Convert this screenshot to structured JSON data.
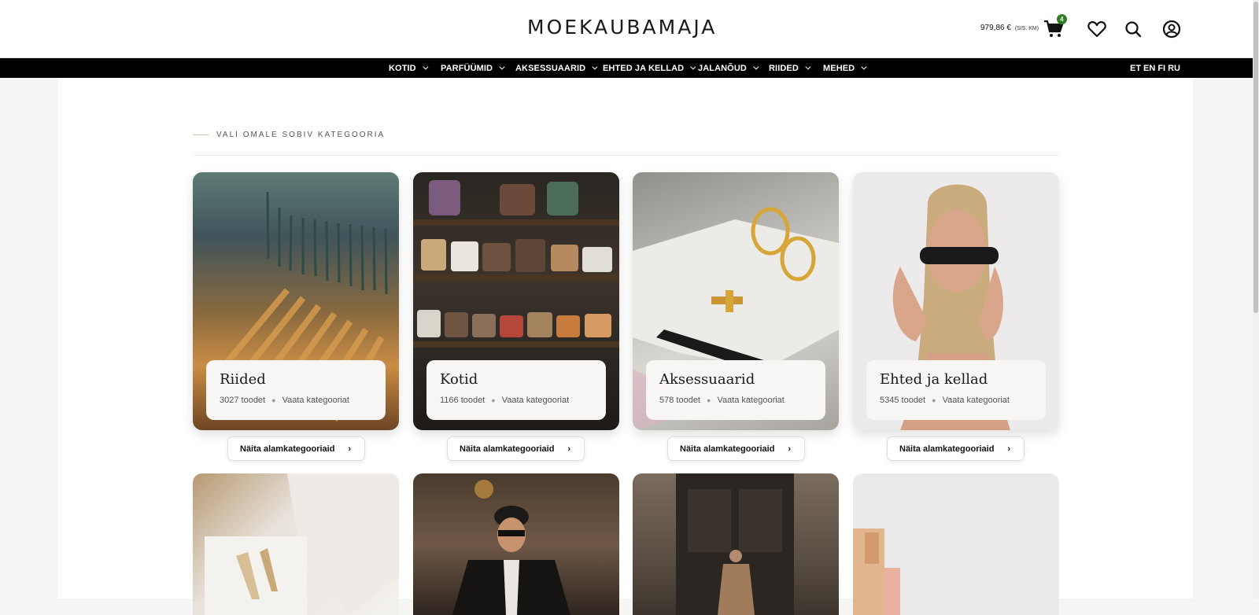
{
  "header": {
    "logo": "MOEKAUBAMAJA",
    "cart_total": "979,86 €",
    "cart_vat": "(SIS. KM)",
    "cart_count": "4"
  },
  "nav": {
    "items": [
      "KOTID",
      "PARFÜÜMID",
      "AKSESSUAARID",
      "EHTED JA KELLAD",
      "JALANÕUD",
      "RIIDED",
      "MEHED"
    ],
    "languages": [
      "ET",
      "EN",
      "FI",
      "RU"
    ]
  },
  "main": {
    "section_label": "VALI OMALE SOBIV KATEGOORIA",
    "cards": [
      {
        "title": "Riided",
        "count": "3027 toodet",
        "link": "Vaata kategooriat",
        "button": "Näita alamkategooriaid"
      },
      {
        "title": "Kotid",
        "count": "1166 toodet",
        "link": "Vaata kategooriat",
        "button": "Näita alamkategooriaid"
      },
      {
        "title": "Aksessuaarid",
        "count": "578 toodet",
        "link": "Vaata kategooriat",
        "button": "Näita alamkategooriaid"
      },
      {
        "title": "Ehted ja kellad",
        "count": "5345 toodet",
        "link": "Vaata kategooriat",
        "button": "Näita alamkategooriaid"
      }
    ]
  },
  "colors": {
    "accent_badge": "#2f7d22",
    "nav_bg": "#000000",
    "page_bg": "#f5f5f4"
  },
  "icons": [
    "cart-icon",
    "heart-icon",
    "search-icon",
    "user-icon",
    "chevron-down-icon",
    "chevron-right-icon"
  ]
}
